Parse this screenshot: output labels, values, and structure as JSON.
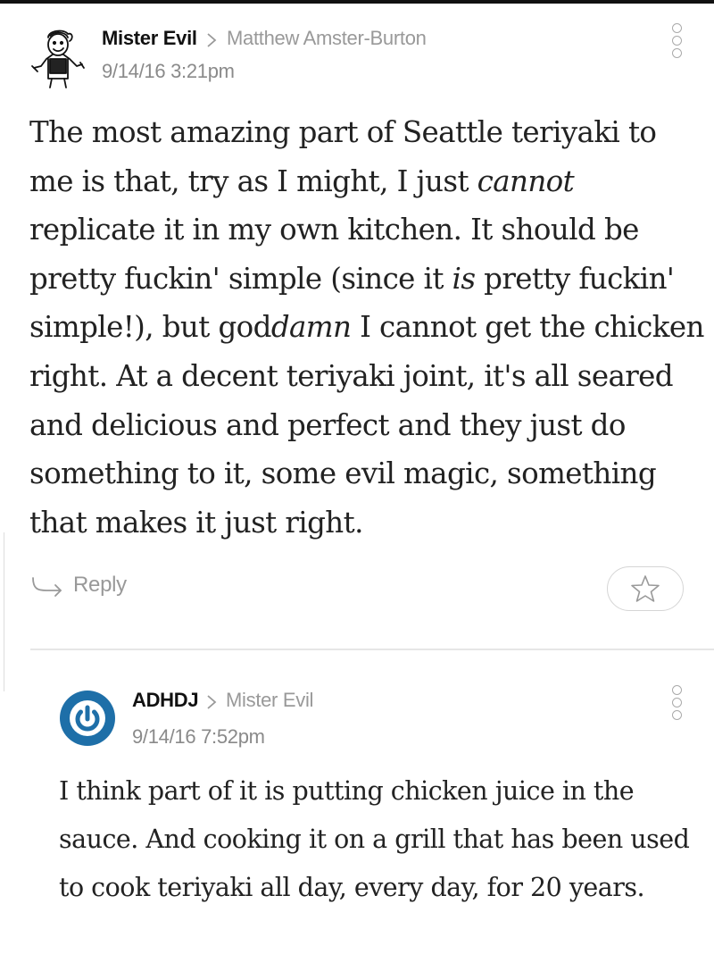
{
  "comments": [
    {
      "author": "Mister Evil",
      "reply_to": "Matthew Amster-Burton",
      "timestamp": "9/14/16 3:21pm",
      "body_parts": [
        "The most amazing part of Seattle teriyaki to me is that, try as I might, I just ",
        "cannot",
        " replicate it in my own kitchen. It should be pretty fuckin' simple (since it ",
        "is",
        " pretty fuckin' simple!), but god",
        "damn",
        " I cannot get the chicken right. At a decent teriyaki joint, it's all seared and delicious and perfect and they just do something to it, some evil magic, something that makes it just right."
      ],
      "reply_label": "Reply",
      "avatar_icon": "vault-boy-avatar",
      "actions": {
        "more_icon": "more-options-icon",
        "star_icon": "star-icon",
        "reply_icon": "reply-arrow-icon"
      }
    },
    {
      "author": "ADHDJ",
      "reply_to": "Mister Evil",
      "timestamp": "9/14/16 7:52pm",
      "body": "I think part of it is putting chicken juice in the sauce. And cooking it on a grill that has been used to cook teriyaki all day, every day, for 20 years.",
      "avatar_icon": "power-button-avatar",
      "accent_color": "#1e6fa8"
    }
  ]
}
